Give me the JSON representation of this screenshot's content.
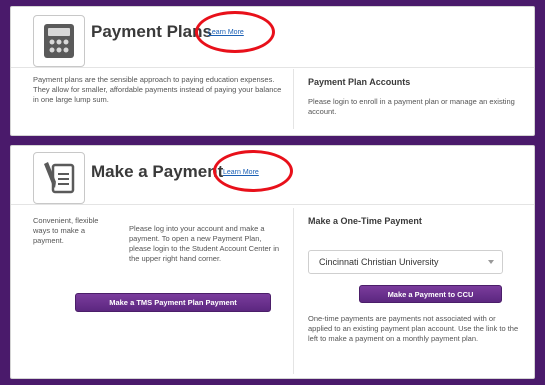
{
  "payment_plans": {
    "title": "Payment Plans",
    "learn_more": "Learn More",
    "description": "Payment plans are the sensible approach to paying education expenses. They allow for smaller, affordable payments instead of paying your balance in one large lump sum.",
    "accounts_title": "Payment Plan Accounts",
    "accounts_text": "Please login to enroll in a payment plan or manage an existing account."
  },
  "make_payment": {
    "title": "Make a Payment",
    "learn_more": "Learn More",
    "intro": "Convenient, flexible ways to make a payment.",
    "login_text": "Please log into your account and make a payment. To open a new Payment Plan, please login to the Student Account Center in the upper right hand corner.",
    "tms_button": "Make a TMS Payment Plan Payment",
    "one_time_title": "Make a One-Time Payment",
    "select_value": "Cincinnati Christian University",
    "ccu_button": "Make a Payment to CCU",
    "one_time_text": "One-time payments are payments not associated with or applied to an existing payment plan account. Use the link to the left to make a payment on a monthly payment plan."
  },
  "colors": {
    "background": "#4a1a6b",
    "button": "#6a2f8e",
    "link": "#1a5fb4",
    "callout": "#e8101a"
  },
  "icons": {
    "payment_plans": "calculator-icon",
    "make_payment": "document-pen-icon"
  }
}
